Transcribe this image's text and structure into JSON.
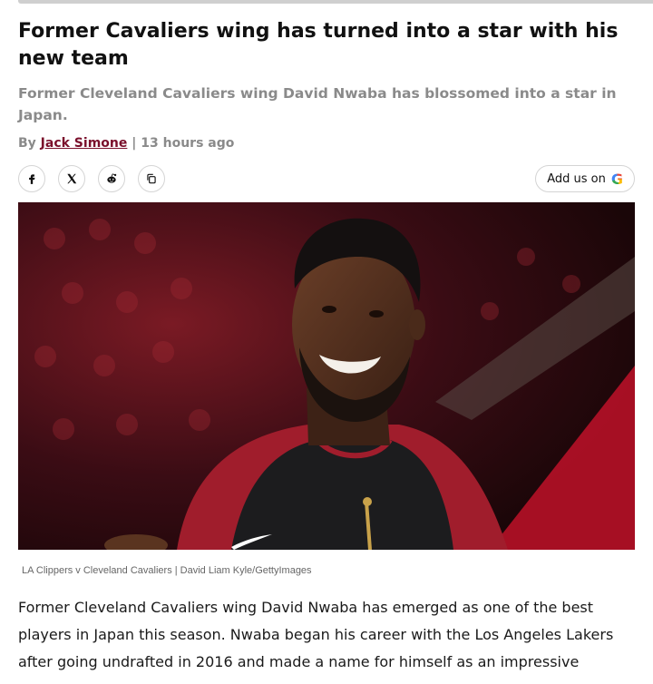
{
  "article": {
    "headline": "Former Cavaliers wing has turned into a star with his new team",
    "subheadline": "Former Cleveland Cavaliers wing David Nwaba has blossomed into a star in Japan.",
    "byline_prefix": "By",
    "author": "Jack Simone",
    "separator": "|",
    "published": "13 hours ago",
    "image_caption": "LA Clippers v Cleveland Cavaliers | David Liam Kyle/GettyImages",
    "body": "Former Cleveland Cavaliers wing David Nwaba has emerged as one of the best players in Japan this season. Nwaba began his career with the Los Angeles Lakers after going undrafted in 2016 and made a name for himself as an impressive"
  },
  "share": {
    "icons": [
      "facebook-icon",
      "x-icon",
      "reddit-icon",
      "copy-link-icon"
    ],
    "add_us_label": "Add us on",
    "add_us_logo": "G"
  },
  "colors": {
    "author_link": "#7a0f2b",
    "subhead": "#8a8a8a",
    "jersey_red": "#a01d2c"
  }
}
